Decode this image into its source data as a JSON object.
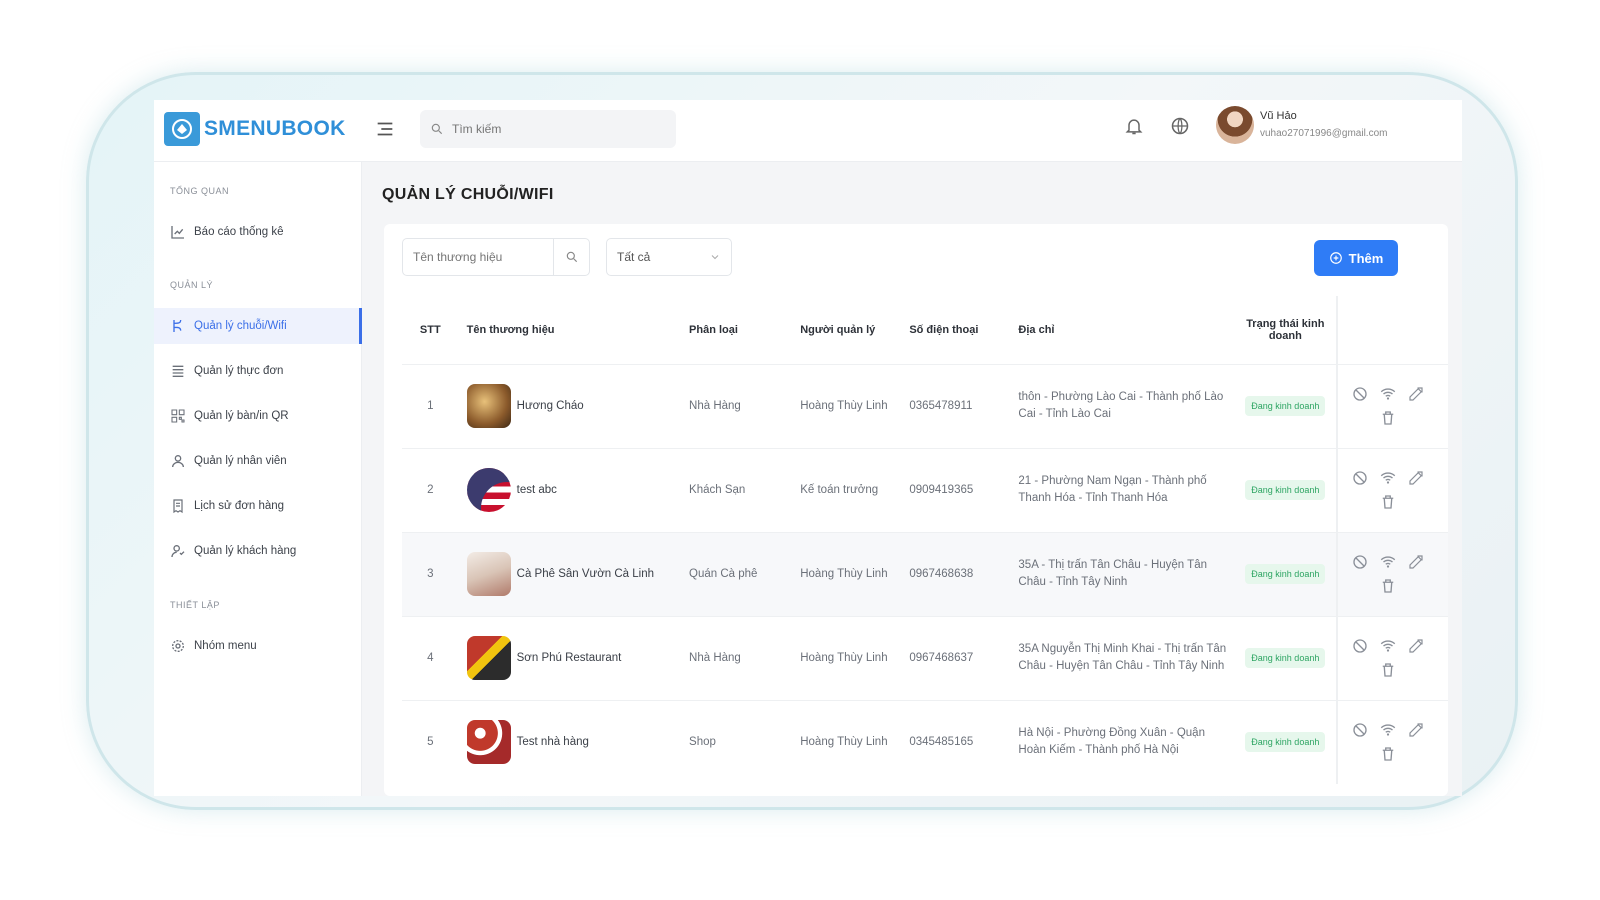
{
  "header": {
    "brand": "SMENUBOOK",
    "search_placeholder": "Tìm kiếm",
    "user_name": "Vũ Hảo",
    "user_email": "vuhao27071996@gmail.com"
  },
  "sidebar": {
    "section_overview": "TỔNG QUAN",
    "section_manage": "QUẢN LÝ",
    "section_settings": "THIẾT LẬP",
    "items": [
      {
        "label": "Báo cáo thống kê",
        "icon": "chart-icon"
      },
      {
        "label": "Quản lý chuỗi/Wifi",
        "icon": "branch-icon"
      },
      {
        "label": "Quản lý thực đơn",
        "icon": "menu-list-icon"
      },
      {
        "label": "Quản lý bàn/in QR",
        "icon": "qr-icon"
      },
      {
        "label": "Quản lý nhân viên",
        "icon": "user-icon"
      },
      {
        "label": "Lịch sử đơn hàng",
        "icon": "receipt-icon"
      },
      {
        "label": "Quản lý khách hàng",
        "icon": "customers-icon"
      },
      {
        "label": "Nhóm menu",
        "icon": "gear-icon"
      }
    ]
  },
  "main": {
    "title": "QUẢN LÝ CHUỖI/WIFI",
    "search_placeholder": "Tên thương hiệu",
    "filter_value": "Tất cả",
    "add_label": "Thêm",
    "columns": [
      "STT",
      "Tên thương hiệu",
      "Phân loại",
      "Người quản lý",
      "Số điện thoại",
      "Địa chỉ",
      "Trạng thái kinh doanh"
    ],
    "rows": [
      {
        "stt": "1",
        "name": "Hương Cháo",
        "type": "Nhà Hàng",
        "manager": "Hoàng Thùy Linh",
        "phone": "0365478911",
        "address": "thôn - Phường Lào Cai - Thành phố Lào Cai - Tỉnh Lào Cai",
        "status": "Đang kinh doanh"
      },
      {
        "stt": "2",
        "name": "test abc",
        "type": "Khách Sạn",
        "manager": "Kế toán trưởng",
        "phone": "0909419365",
        "address": "21 - Phường Nam Ngạn - Thành phố Thanh Hóa - Tỉnh Thanh Hóa",
        "status": "Đang kinh doanh"
      },
      {
        "stt": "3",
        "name": "Cà Phê Sân Vườn Cà Linh",
        "type": "Quán Cà phê",
        "manager": "Hoàng Thùy Linh",
        "phone": "0967468638",
        "address": "35A - Thị trấn Tân Châu - Huyện Tân Châu - Tỉnh Tây Ninh",
        "status": "Đang kinh doanh"
      },
      {
        "stt": "4",
        "name": "Sơn Phú Restaurant",
        "type": "Nhà Hàng",
        "manager": "Hoàng Thùy Linh",
        "phone": "0967468637",
        "address": "35A Nguyễn Thị Minh Khai - Thị trấn Tân Châu - Huyện Tân Châu - Tỉnh Tây Ninh",
        "status": "Đang kinh doanh"
      },
      {
        "stt": "5",
        "name": "Test nhà hàng",
        "type": "Shop",
        "manager": "Hoàng Thùy Linh",
        "phone": "0345485165",
        "address": "Hà Nội - Phường Đồng Xuân - Quận Hoàn Kiếm - Thành phố Hà Nội",
        "status": "Đang kinh doanh"
      }
    ]
  },
  "colors": {
    "primary": "#2f7cf6",
    "brand": "#2f8fd8",
    "status_bg": "#e6f7ec",
    "status_text": "#2ea563"
  }
}
